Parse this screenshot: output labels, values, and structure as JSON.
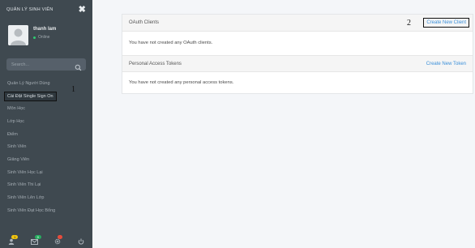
{
  "sidebar": {
    "brand": "QUẢN LÝ SINH VIÊN",
    "user": {
      "name": "thanh lam",
      "status": "Online"
    },
    "search": {
      "placeholder": "Search..."
    },
    "menu": [
      {
        "label": "Quản Lý Người Dùng"
      },
      {
        "label": "Cài Đặt Single Sign On",
        "active": true
      },
      {
        "label": "Môn Học"
      },
      {
        "label": "Lớp Học"
      },
      {
        "label": "Điểm"
      },
      {
        "label": "Sinh Viên"
      },
      {
        "label": "Giảng Viên"
      },
      {
        "label": "Sinh Viên Học Lại"
      },
      {
        "label": "Sinh Viên Thi Lại"
      },
      {
        "label": "Sinh Viên Lên Lớp"
      },
      {
        "label": "Sinh Viên Đạt Học Bổng"
      }
    ],
    "annotation": "1",
    "footer": {
      "badges": [
        "1",
        "9",
        ""
      ]
    }
  },
  "main": {
    "annotation": "2",
    "oauth": {
      "title": "OAuth Clients",
      "action": "Create New Client",
      "empty": "You have not created any OAuth clients."
    },
    "tokens": {
      "title": "Personal Access Tokens",
      "action": "Create New Token",
      "empty": "You have not created any personal access tokens."
    }
  },
  "colors": {
    "sidebar": "#3f4950",
    "link": "#3b8fd9",
    "online": "#2ecc71"
  },
  "icons": [
    "close-icon",
    "avatar",
    "search-icon",
    "user-icon",
    "envelope-icon",
    "gear-icon",
    "power-icon"
  ]
}
